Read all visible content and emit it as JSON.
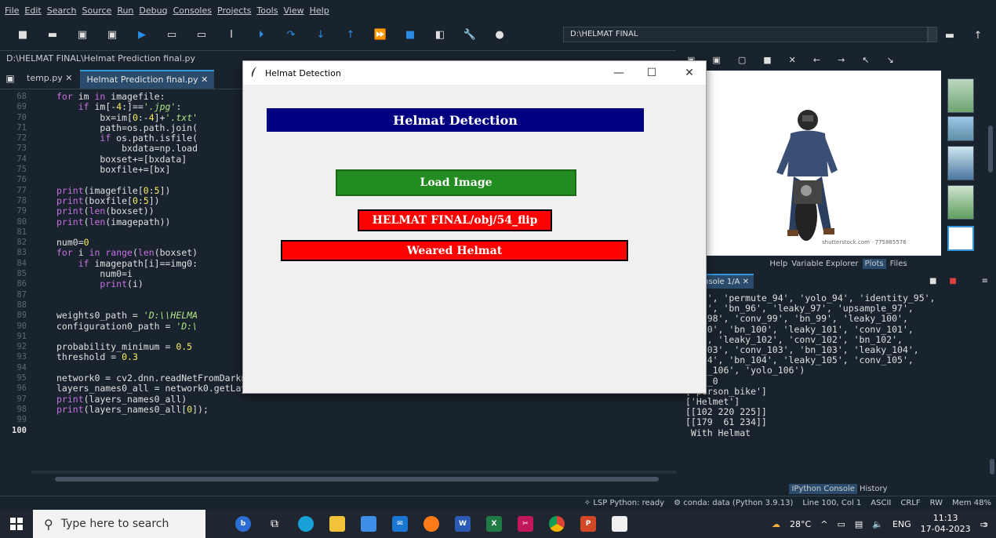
{
  "menu": [
    "File",
    "Edit",
    "Search",
    "Source",
    "Run",
    "Debug",
    "Consoles",
    "Projects",
    "Tools",
    "View",
    "Help"
  ],
  "toolbar": {
    "working_dir": "D:\\HELMAT FINAL"
  },
  "editor": {
    "file_path": "D:\\HELMAT FINAL\\Helmat Prediction final.py",
    "tabs": [
      {
        "label": "temp.py ✕",
        "active": false
      },
      {
        "label": "Helmat Prediction final.py ✕",
        "active": true
      }
    ],
    "line_numbers": [
      "68",
      "69",
      "70",
      "71",
      "72",
      "73",
      "74",
      "75",
      "76",
      "77",
      "78",
      "79",
      "80",
      "81",
      "82",
      "83",
      "84",
      "85",
      "86",
      "87",
      "88",
      "89",
      "90",
      "91",
      "92",
      "93",
      "94",
      "95",
      "96",
      "97",
      "98",
      "99",
      "100"
    ]
  },
  "plots": {
    "watermark": "shutterstock.com · 775885576",
    "tabs": [
      "Help",
      "Variable Explorer",
      "Plots",
      "Files"
    ],
    "active_tab": "Plots"
  },
  "console": {
    "tab": "Console 1/A ✕",
    "lines": [
      "v_93', 'permute_94', 'yolo_94', 'identity_95',",
      "v_96', 'bn_96', 'leaky_97', 'upsample_97',",
      "cat_98', 'conv_99', 'bn_99', 'leaky_100',",
      "v_100', 'bn_100', 'leaky_101', 'conv_101',",
      "101', 'leaky_102', 'conv_102', 'bn_102',",
      "ky_103', 'conv_103', 'bn_103', 'leaky_104',",
      "v_104', 'bn_104', 'leaky_105', 'conv_105',",
      "mute_106', 'yolo_106')",
      "conv_0",
      "['person_bike']",
      "['Helmet']",
      "[[102 220 225]]",
      "[[179  61 234]]",
      " With Helmat"
    ],
    "tabs": [
      "IPython Console",
      "History"
    ],
    "active_tab": "IPython Console"
  },
  "status": {
    "lsp": "LSP Python: ready",
    "conda": "conda: data (Python 3.9.13)",
    "position": "Line 100, Col 1",
    "encoding": "ASCII",
    "eol": "CRLF",
    "perm": "RW",
    "mem": "Mem 48%"
  },
  "taskbar": {
    "search_placeholder": "Type here to search",
    "weather": "28°C",
    "lang": "ENG",
    "time": "11:13",
    "date": "17-04-2023",
    "notif_count": "3"
  },
  "dialog": {
    "title": "Helmat Detection",
    "header": "Helmat Detection",
    "load_button": "Load Image",
    "path_label": "HELMAT FINAL/obj/54_flip",
    "result": "Weared Helmat",
    "colors": {
      "header_bg": "#000080",
      "button_bg": "#228b22",
      "label_bg": "#ff0000"
    }
  }
}
